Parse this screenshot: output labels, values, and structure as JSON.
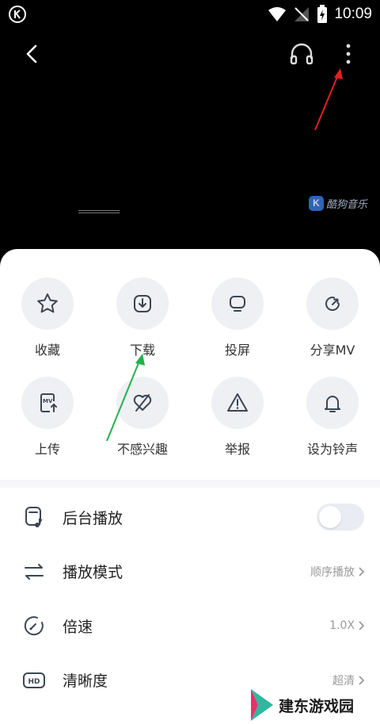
{
  "status_bar": {
    "time": "10:09"
  },
  "video": {
    "watermark": "酷狗音乐",
    "watermark_letter": "K"
  },
  "actions": [
    {
      "label": "收藏",
      "icon": "star-icon"
    },
    {
      "label": "下载",
      "icon": "download-icon"
    },
    {
      "label": "投屏",
      "icon": "cast-screen-icon"
    },
    {
      "label": "分享MV",
      "icon": "share-icon"
    },
    {
      "label": "上传",
      "icon": "upload-mv-icon"
    },
    {
      "label": "不感兴趣",
      "icon": "not-interested-icon"
    },
    {
      "label": "举报",
      "icon": "report-warning-icon"
    },
    {
      "label": "设为铃声",
      "icon": "bell-icon"
    }
  ],
  "menu": [
    {
      "label": "后台播放",
      "icon": "background-play-icon",
      "toggle_on": false
    },
    {
      "label": "播放模式",
      "icon": "play-mode-icon",
      "value": "顺序播放"
    },
    {
      "label": "倍速",
      "icon": "speed-gauge-icon",
      "value": "1.0X"
    },
    {
      "label": "清晰度",
      "icon": "hd-icon",
      "value": "超清"
    }
  ],
  "site_watermark": "建东游戏园",
  "colors": {
    "annotation_red": "#e02020",
    "annotation_green": "#22b14c",
    "sheet_bg": "#ffffff",
    "circle_bg": "#eff0f4"
  }
}
